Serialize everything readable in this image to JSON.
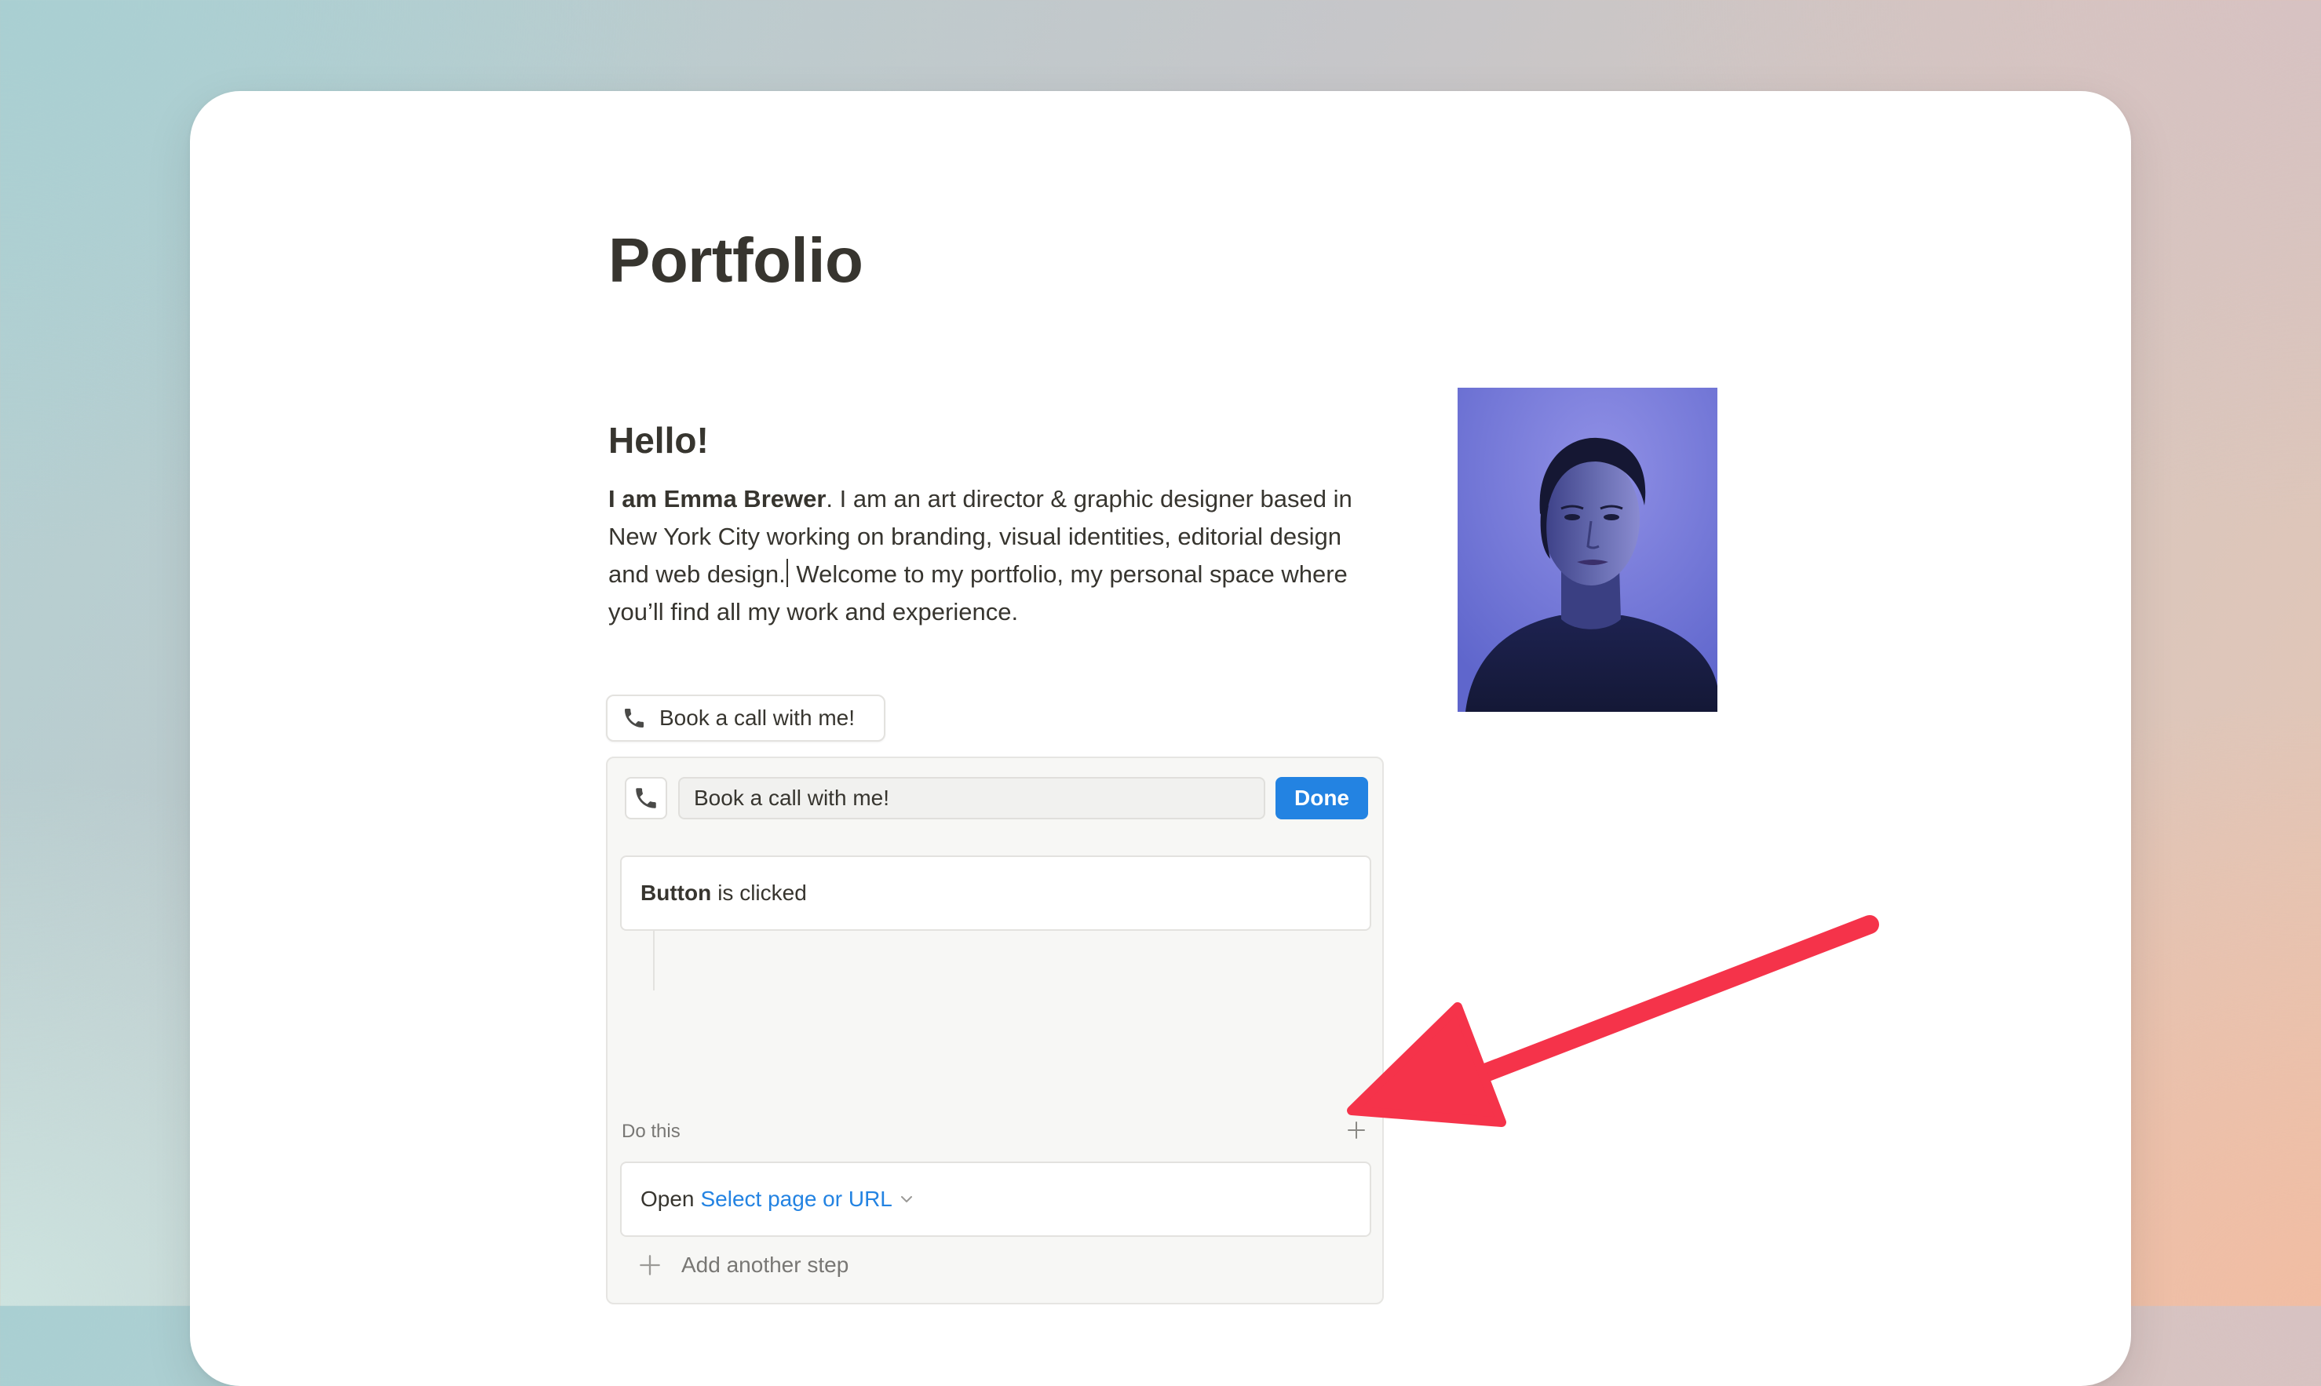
{
  "page": {
    "title": "Portfolio"
  },
  "content": {
    "heading": "Hello!",
    "intro_bold": "I am Emma Brewer",
    "intro_part1": ". I am an art director & graphic designer based in New York City working on branding, visual identities, editorial design and web design.",
    "intro_part2": " Welcome to my portfolio, my personal space where you’ll find all my work and experience."
  },
  "button_block": {
    "icon": "phone-icon",
    "label": "Book a call with me!"
  },
  "editor": {
    "label_value": "Book a call with me!",
    "done_label": "Done",
    "trigger": {
      "strong": "Button",
      "text": "is clicked"
    },
    "do_this_label": "Do this",
    "action": {
      "verb": "Open",
      "link": "Select page or URL"
    },
    "add_step_label": "Add another step"
  },
  "colors": {
    "accent": "#2383e2",
    "annotation_arrow": "#f5334a",
    "text": "#37352f",
    "muted": "#787774"
  }
}
